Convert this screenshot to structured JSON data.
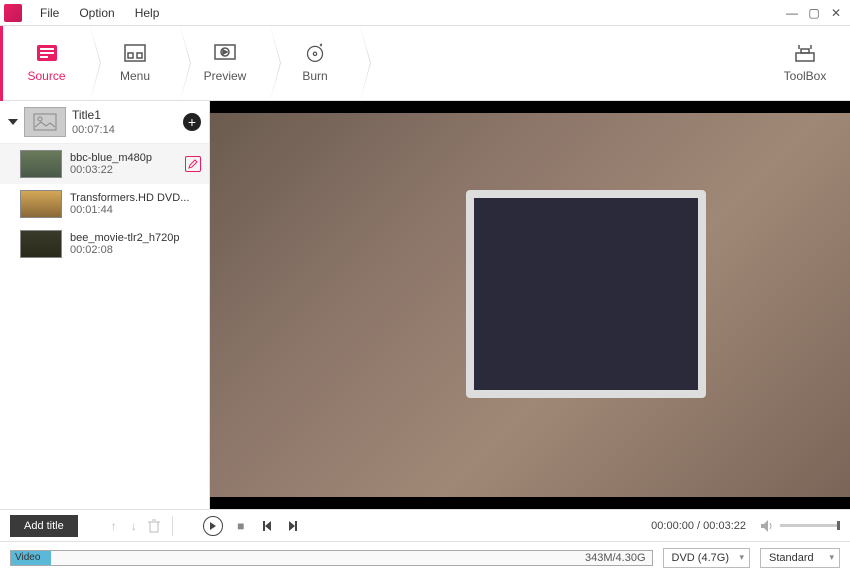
{
  "menu": {
    "file": "File",
    "option": "Option",
    "help": "Help"
  },
  "tabs": {
    "source": "Source",
    "menu": "Menu",
    "preview": "Preview",
    "burn": "Burn",
    "toolbox": "ToolBox"
  },
  "sidebar": {
    "title": {
      "name": "Title1",
      "duration": "00:07:14"
    },
    "clips": [
      {
        "name": "bbc-blue_m480p",
        "duration": "00:03:22"
      },
      {
        "name": "Transformers.HD DVD...",
        "duration": "00:01:44"
      },
      {
        "name": "bee_movie-tlr2_h720p",
        "duration": "00:02:08"
      }
    ]
  },
  "controls": {
    "add_title": "Add title",
    "time_current": "00:00:00",
    "time_total": "00:03:22"
  },
  "bottom": {
    "video_label": "Video",
    "size": "343M/4.30G",
    "disc": "DVD (4.7G)",
    "quality": "Standard"
  }
}
